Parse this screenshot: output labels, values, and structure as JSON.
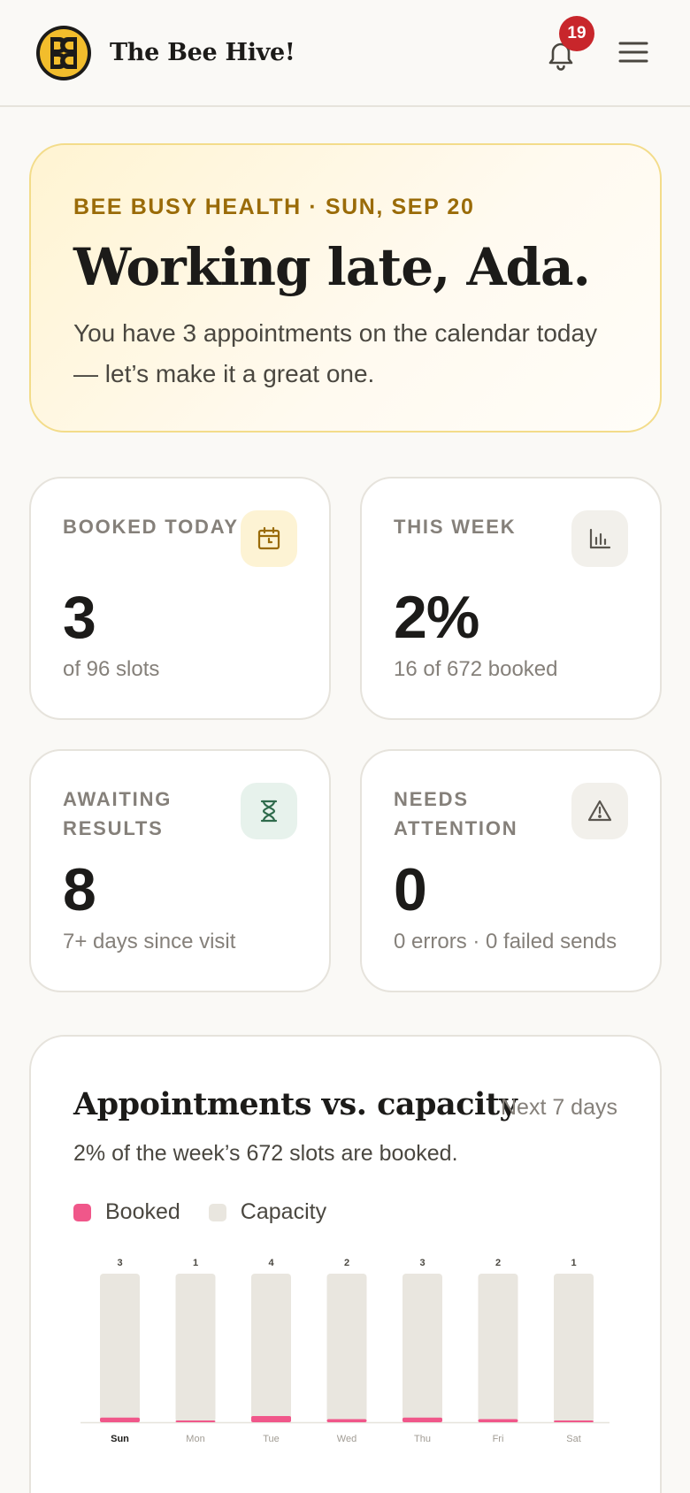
{
  "header": {
    "title": "The Bee Hive!",
    "notification_count": "19",
    "logo_icon": "bee-hive-logo",
    "bell_icon": "bell-icon",
    "menu_icon": "hamburger-menu-icon"
  },
  "hero": {
    "eyebrow": "BEE BUSY HEALTH · SUN, SEP 20",
    "title": "Working late, Ada.",
    "text": "You have 3 appointments on the calendar today — let’s make it a great one."
  },
  "stats": [
    {
      "label": "BOOKED TODAY",
      "value": "3",
      "sub": "of 96 slots",
      "icon": "calendar-icon",
      "icon_bg": "#fdf3d4",
      "icon_color": "#9a6b08"
    },
    {
      "label": "THIS WEEK",
      "value": "2%",
      "sub": "16 of 672 booked",
      "icon": "bar-chart-icon",
      "icon_bg": "#f2f0eb",
      "icon_color": "#5a564f"
    },
    {
      "label": "AWAITING RESULTS",
      "value": "8",
      "sub": "7+ days since visit",
      "icon": "hourglass-icon",
      "icon_bg": "#e7f2ec",
      "icon_color": "#2f6b4c"
    },
    {
      "label": "NEEDS ATTENTION",
      "value": "0",
      "sub": "0 errors · 0 failed sends",
      "icon": "warning-triangle-icon",
      "icon_bg": "#f2f0eb",
      "icon_color": "#5a564f"
    }
  ],
  "chart": {
    "title": "Appointments vs. capacity",
    "range": "Next 7 days",
    "subtitle": "2% of the week’s 672 slots are booked.",
    "legend_booked": "Booked",
    "legend_capacity": "Capacity"
  },
  "chart_data": {
    "type": "bar",
    "categories": [
      "Sun",
      "Mon",
      "Tue",
      "Wed",
      "Thu",
      "Fri",
      "Sat"
    ],
    "series": [
      {
        "name": "Booked",
        "values": [
          3,
          1,
          4,
          2,
          3,
          2,
          1
        ]
      },
      {
        "name": "Capacity",
        "values": [
          96,
          96,
          96,
          96,
          96,
          96,
          96
        ]
      }
    ],
    "ylim": [
      0,
      96
    ],
    "highlighted_category": "Sun",
    "colors": {
      "booked": "#f0578a",
      "capacity": "#e9e6df"
    }
  }
}
